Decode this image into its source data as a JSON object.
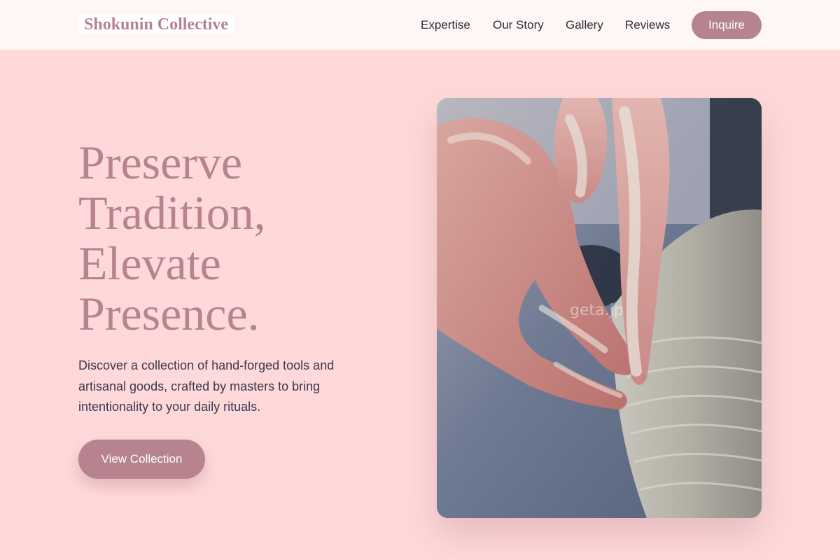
{
  "header": {
    "logo": "Shokunin Collective",
    "nav": {
      "expertise": "Expertise",
      "story": "Our Story",
      "gallery": "Gallery",
      "reviews": "Reviews"
    },
    "cta": "Inquire"
  },
  "hero": {
    "headline_lines": [
      "Preserve",
      "Tradition,",
      "Elevate",
      "Presence."
    ],
    "description": "Discover a collection of hand-forged tools and artisanal goods, crafted by masters to bring intentionality to your daily rituals.",
    "cta": "View Collection",
    "image": {
      "subject": "hands-shaping-clay-on-pottery-wheel",
      "watermark": "geta.jp"
    }
  },
  "colors": {
    "background": "#ffd9d9",
    "header_bg": "#fff6f6",
    "accent": "#b6838f",
    "text": "#3a3850"
  }
}
